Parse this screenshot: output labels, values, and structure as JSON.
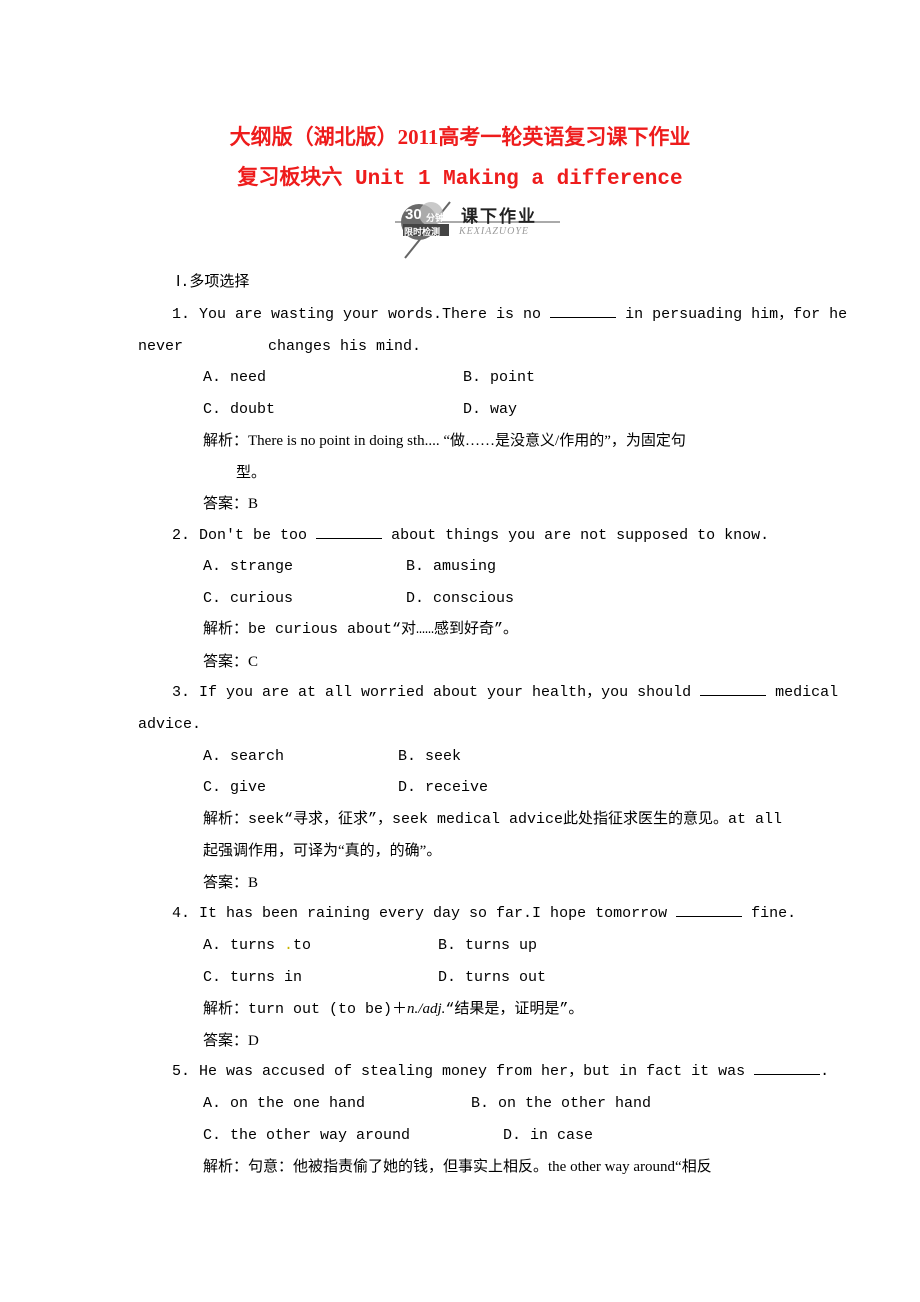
{
  "header": {
    "title_line1": "大纲版（湖北版）2011高考一轮英语复习课下作业",
    "title_line2": "复习板块六  Unit 1  Making a difference",
    "logo": {
      "badge_number": "30",
      "badge_unit": "分钟",
      "badge_subtitle": "限时检测",
      "label": "课下作业",
      "pinyin": "KEXIAZUOYE"
    }
  },
  "section": {
    "heading": "Ⅰ.多项选择"
  },
  "questions": [
    {
      "stem_line1": "1. You are wasting your words.There is no",
      "stem_after_blank": "in persuading him，for he",
      "stem_line2a": "never",
      "stem_line2b": "changes his mind.",
      "options": [
        "A. need",
        "B. point",
        "C. doubt",
        "D. way"
      ],
      "analysis_line1": "解析：There is no point in doing sth.... “做……是没意义/作用的”，为固定句",
      "analysis_line2": "型。",
      "answer": "答案：B"
    },
    {
      "stem_before_blank": "2. Don′t be too",
      "stem_after_blank": "about things you are not supposed to know.",
      "options": [
        "A. strange",
        "B. amusing",
        "C. curious",
        "D. conscious"
      ],
      "analysis_line1": "解析：be curious about“对……感到好奇”。",
      "answer": "答案：C"
    },
    {
      "stem_before_blank": "3. If you are at all worried about your health，you should",
      "stem_after_blank": "medical",
      "stem_line2": "advice.",
      "options": [
        "A. search",
        "B. seek",
        "C. give",
        "D. receive"
      ],
      "analysis_line1": "解析：seek“寻求，征求”，seek medical advice此处指征求医生的意见。at all",
      "analysis_line2": "起强调作用，可译为“真的，的确”。",
      "answer": "答案：B"
    },
    {
      "stem_before_blank": "4. It has been raining every day so far.I hope tomorrow",
      "stem_after_blank": "fine.",
      "options": [
        "A. turns",
        "B. turns up",
        "C. turns in",
        "D. turns out"
      ],
      "option_a_suffix": "to",
      "analysis_pre": "解析：turn out (to be)＋",
      "analysis_ital": "n./adj.",
      "analysis_post": "“结果是，证明是”。",
      "answer": "答案：D"
    },
    {
      "stem_before_blank": "5. He was accused of stealing money from her，but in fact it was",
      "stem_after_blank": ".",
      "options": [
        "A. on the one hand",
        "B. on the other hand",
        "C. the other way around",
        "D. in case"
      ],
      "analysis_line1": "解析：句意：他被指责偷了她的钱，但事实上相反。the other way around“相反"
    }
  ],
  "colors": {
    "title_red": "#ee1c1c"
  }
}
